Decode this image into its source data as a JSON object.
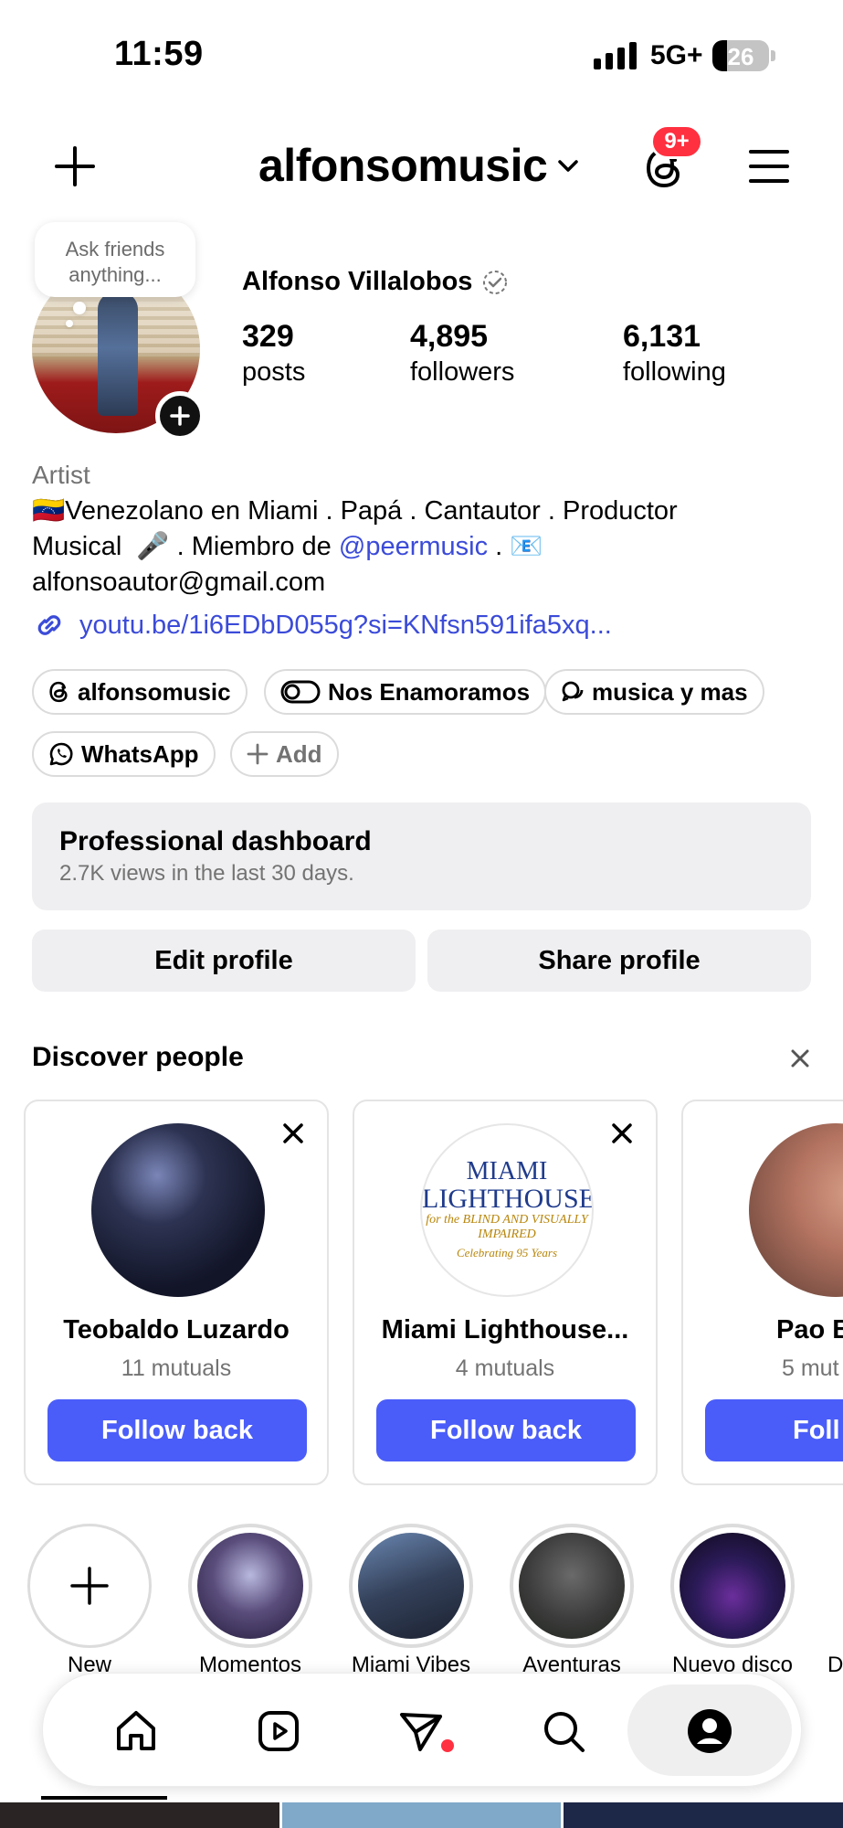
{
  "status_bar": {
    "time": "11:59",
    "network": "5G+",
    "battery": "26",
    "battery_level": 0.26
  },
  "header": {
    "username": "alfonsomusic",
    "notification_badge": "9+"
  },
  "note": {
    "text": "Ask friends anything..."
  },
  "profile": {
    "full_name": "Alfonso Villalobos",
    "stats": [
      {
        "value": "329",
        "label": "posts"
      },
      {
        "value": "4,895",
        "label": "followers"
      },
      {
        "value": "6,131",
        "label": "following"
      }
    ],
    "category": "Artist",
    "bio_line1": "🇻🇪Venezolano en Miami . Papá . Cantautor . Productor",
    "bio_line2_pre": "Musical  🎤 . Miembro de ",
    "bio_mention": "@peermusic",
    "bio_line2_post": " . 📧",
    "bio_line3": "alfonsoautor@gmail.com",
    "link": "youtu.be/1i6EDbD055g?si=KNfsn591ifa5xq..."
  },
  "chips": [
    {
      "label": "alfonsomusic",
      "icon": "threads-icon"
    },
    {
      "label": "Nos Enamoramos",
      "icon": "music-chip-icon"
    },
    {
      "label": "musica y mas",
      "icon": "chat-icon"
    },
    {
      "label": "WhatsApp",
      "icon": "whatsapp-icon"
    },
    {
      "label": "Add",
      "icon": "plus-icon"
    }
  ],
  "dashboard": {
    "title": "Professional dashboard",
    "subtitle": "2.7K views in the last 30 days."
  },
  "buttons": {
    "edit_profile": "Edit profile",
    "share_profile": "Share profile"
  },
  "discover": {
    "title": "Discover people",
    "cards": [
      {
        "name": "Teobaldo Luzardo",
        "mutuals": "11 mutuals",
        "action": "Follow back"
      },
      {
        "name": "Miami Lighthouse...",
        "mutuals": "4 mutuals",
        "action": "Follow back",
        "logo_line1": "MIAMI",
        "logo_line2": "LIGHTHOUSE",
        "logo_line3": "for the BLIND AND VISUALLY IMPAIRED",
        "logo_line4": "Celebrating 95 Years"
      },
      {
        "name": "Pao B",
        "mutuals": "5 mut",
        "action": "Foll"
      }
    ]
  },
  "highlights": [
    {
      "label": "New"
    },
    {
      "label": "Momentos"
    },
    {
      "label": "Miami Vibes"
    },
    {
      "label": "Aventuras"
    },
    {
      "label": "Nuevo disco"
    },
    {
      "label": "D"
    }
  ],
  "colors": {
    "accent_blue": "#4a5df9",
    "link_blue": "#3b4bd8",
    "badge_red": "#ff3040"
  }
}
